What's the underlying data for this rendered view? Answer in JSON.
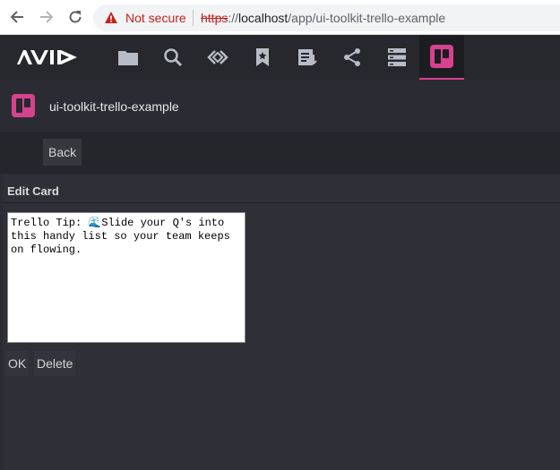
{
  "browser": {
    "security_label": "Not secure",
    "url_scheme": "https",
    "url_sep": "://",
    "url_host": "localhost",
    "url_path": "/app/ui-toolkit-trello-example"
  },
  "toolbar": {
    "logo_text": "AVID",
    "icons": [
      "folder-icon",
      "search-icon",
      "link-icon",
      "bookmark-icon",
      "download-list-icon",
      "share-icon",
      "server-icon",
      "trello-icon"
    ],
    "active_icon": "trello-icon",
    "accent_color": "#d6428f"
  },
  "title_row": {
    "title": "ui-toolkit-trello-example"
  },
  "nav": {
    "back_label": "Back"
  },
  "edit_card": {
    "heading": "Edit Card",
    "text_value": "Trello Tip: 🌊Slide your Q's into this handy list so your team keeps on flowing.",
    "ok_label": "OK",
    "delete_label": "Delete"
  }
}
